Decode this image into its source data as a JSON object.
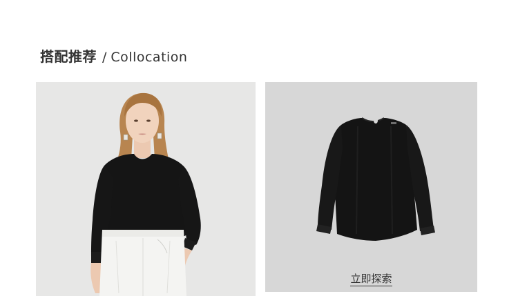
{
  "section": {
    "title_zh": "搭配推荐",
    "separator": "/",
    "title_en": "Collocation"
  },
  "cards": {
    "model_photo": {
      "description_icon": "model-wearing-black-blouse-image"
    },
    "product_photo": {
      "description_icon": "black-blouse-product-image",
      "link_label": "立即探索"
    }
  },
  "colors": {
    "title": "#333333",
    "model_bg": "#e6e6e6",
    "product_bg": "#d7d7d7",
    "garment": "#141414",
    "pants": "#f4f4f2"
  }
}
